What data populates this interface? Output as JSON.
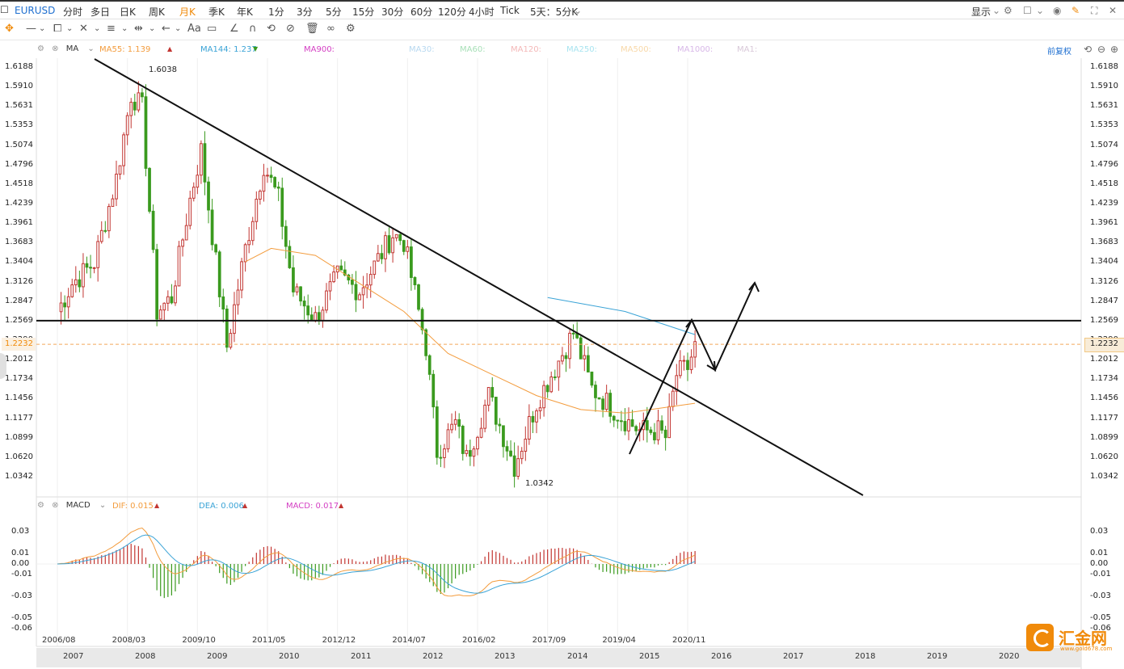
{
  "topbar": {
    "symbol": "EURUSD",
    "periods": [
      "分时",
      "多日",
      "日K",
      "周K",
      "月K",
      "季K",
      "年K",
      "1分",
      "3分",
      "5分",
      "15分",
      "30分",
      "60分",
      "120分",
      "4小时",
      "Tick",
      "5天：5分K"
    ],
    "active_period": "月K",
    "display_label": "显示"
  },
  "main_legend": {
    "indicator": "MA",
    "ma55": "MA55: 1.139",
    "ma144": "MA144: 1.237",
    "ma900": "MA900:",
    "ma30": "MA30:",
    "ma60": "MA60:",
    "ma120": "MA120:",
    "ma250": "MA250:",
    "ma500": "MA500:",
    "ma1000": "MA1000:",
    "ma1": "MA1:",
    "adjust": "前复权"
  },
  "macd_legend": {
    "indicator": "MACD",
    "dif": "DIF: 0.015",
    "dea": "DEA: 0.006",
    "macd": "MACD: 0.017"
  },
  "price_labels": {
    "high": "1.6038",
    "low": "1.0342",
    "current": "1.2232"
  },
  "colors": {
    "up": "#c23531",
    "down": "#3a9a1e",
    "ma55": "#f39c3d",
    "ma144": "#3aa3d6",
    "dif": "#f39c3d",
    "dea": "#3aa3d6",
    "macd_pink": "#d43fc3",
    "accent": "#1e6fd0"
  },
  "chart_data": {
    "type": "candlestick",
    "main_y_ticks": [
      "1.6188",
      "1.5910",
      "1.5631",
      "1.5353",
      "1.5074",
      "1.4796",
      "1.4518",
      "1.4239",
      "1.3961",
      "1.3683",
      "1.3404",
      "1.3126",
      "1.2847",
      "1.2569",
      "1.2290",
      "1.2012",
      "1.1734",
      "1.1456",
      "1.1177",
      "1.0899",
      "1.0620",
      "1.0342"
    ],
    "macd_y_ticks": [
      "0.03",
      "0.01",
      "0.00",
      "-0.01",
      "-0.03",
      "-0.05",
      "-0.06"
    ],
    "x_top_labels": [
      "2006/08",
      "2008/03",
      "2009/10",
      "2011/05",
      "2012/12",
      "2014/07",
      "2016/02",
      "2017/09",
      "2019/04",
      "2020/11"
    ],
    "x_bottom_labels": [
      "2007",
      "2008",
      "2009",
      "2010",
      "2011",
      "2012",
      "2013",
      "2014",
      "2015",
      "2016",
      "2017",
      "2018",
      "2019",
      "2020"
    ],
    "ylim": [
      1.02,
      1.625
    ],
    "macd_ylim": [
      -0.065,
      0.04
    ],
    "anchors": [
      [
        "2006/08",
        1.27
      ],
      [
        "2006/12",
        1.31
      ],
      [
        "2007/06",
        1.34
      ],
      [
        "2007/12",
        1.46
      ],
      [
        "2008/04",
        1.58
      ],
      [
        "2008/07",
        1.56
      ],
      [
        "2008/11",
        1.27
      ],
      [
        "2009/03",
        1.29
      ],
      [
        "2009/08",
        1.43
      ],
      [
        "2009/11",
        1.5
      ],
      [
        "2010/06",
        1.22
      ],
      [
        "2010/11",
        1.36
      ],
      [
        "2011/04",
        1.48
      ],
      [
        "2011/08",
        1.43
      ],
      [
        "2011/12",
        1.3
      ],
      [
        "2012/06",
        1.26
      ],
      [
        "2012/12",
        1.32
      ],
      [
        "2013/06",
        1.3
      ],
      [
        "2014/03",
        1.38
      ],
      [
        "2014/06",
        1.37
      ],
      [
        "2014/12",
        1.22
      ],
      [
        "2015/03",
        1.07
      ],
      [
        "2015/08",
        1.11
      ],
      [
        "2015/11",
        1.06
      ],
      [
        "2016/05",
        1.15
      ],
      [
        "2016/12",
        1.05
      ],
      [
        "2017/06",
        1.14
      ],
      [
        "2017/12",
        1.2
      ],
      [
        "2018/04",
        1.24
      ],
      [
        "2018/09",
        1.16
      ],
      [
        "2019/05",
        1.12
      ],
      [
        "2019/10",
        1.1
      ],
      [
        "2020/03",
        1.1
      ],
      [
        "2020/05",
        1.09
      ],
      [
        "2020/08",
        1.18
      ],
      [
        "2020/11",
        1.19
      ],
      [
        "2021/01",
        1.22
      ]
    ],
    "ma55_curve": [
      [
        1.341,
        "2010/11"
      ],
      [
        1.36,
        "2011/06"
      ],
      [
        1.35,
        "2012/06"
      ],
      [
        1.31,
        "2013/06"
      ],
      [
        1.27,
        "2014/06"
      ],
      [
        1.21,
        "2015/06"
      ],
      [
        1.18,
        "2016/06"
      ],
      [
        1.15,
        "2017/06"
      ],
      [
        1.13,
        "2018/06"
      ],
      [
        1.125,
        "2019/06"
      ],
      [
        1.139,
        "2021/01"
      ]
    ],
    "ma144_curve": [
      [
        1.29,
        "2017/09"
      ],
      [
        1.27,
        "2019/06"
      ],
      [
        1.237,
        "2021/01"
      ]
    ],
    "series": [
      {
        "name": "DIF",
        "values": []
      },
      {
        "name": "DEA",
        "values": []
      },
      {
        "name": "MACD",
        "values": []
      }
    ],
    "annotations": {
      "resistance_level": 1.2569,
      "current_price": 1.2232,
      "trendline_from": [
        "2008/06",
        1.6188
      ],
      "trendline_to": [
        "2025/12",
        1.02
      ],
      "high_point": 1.6038,
      "low_point": 1.0342
    }
  }
}
